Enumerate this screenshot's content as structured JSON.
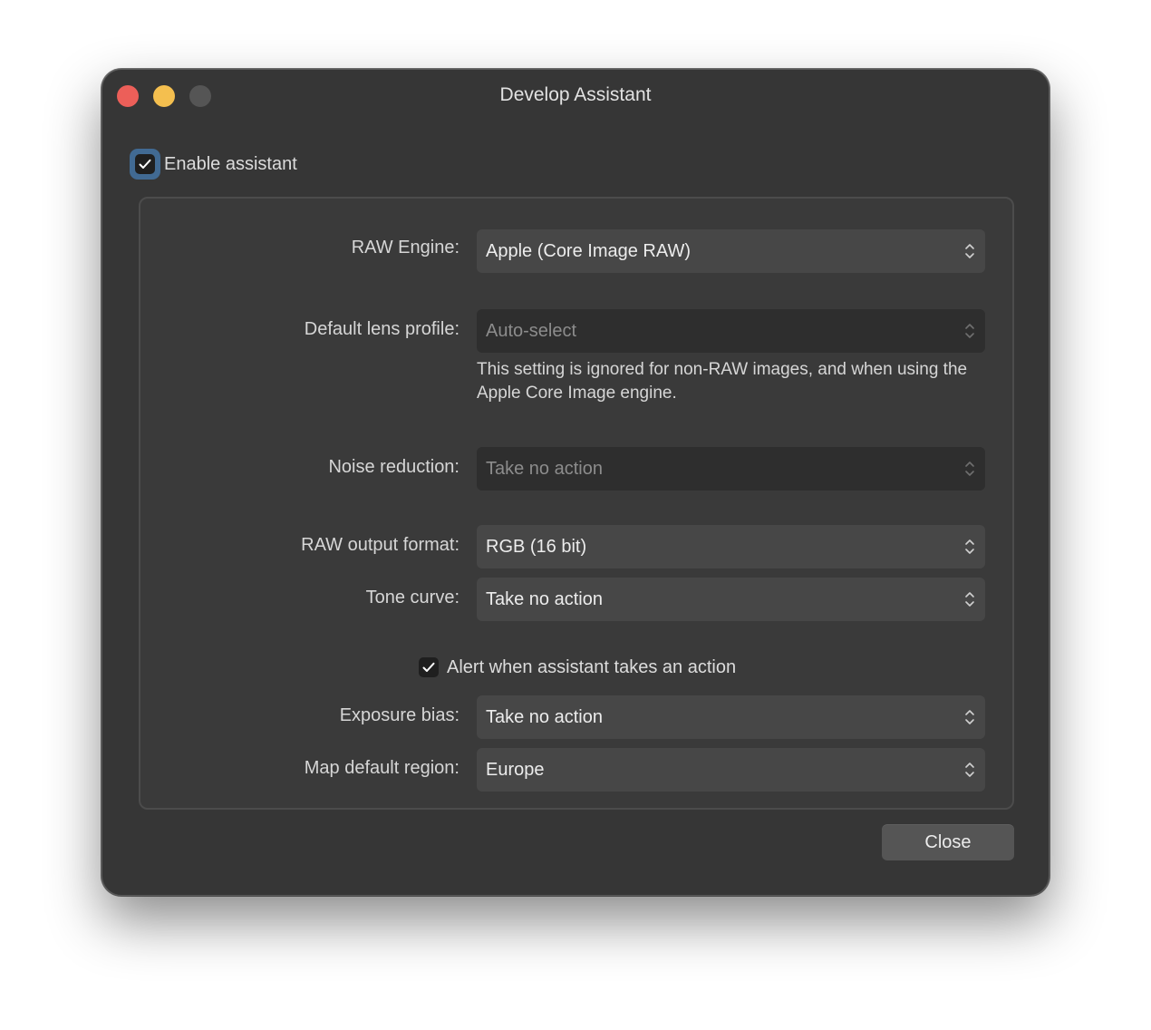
{
  "window": {
    "title": "Develop Assistant",
    "traffic_lights": [
      "close",
      "minimize",
      "zoom"
    ]
  },
  "enable_assistant": {
    "label": "Enable assistant",
    "checked": true
  },
  "settings": {
    "raw_engine": {
      "label": "RAW Engine:",
      "value": "Apple (Core Image RAW)",
      "enabled": true
    },
    "default_lens_profile": {
      "label": "Default lens profile:",
      "value": "Auto-select",
      "enabled": false
    },
    "lens_note": "This setting is ignored for non-RAW images, and when using the Apple Core Image engine.",
    "noise_reduction": {
      "label": "Noise reduction:",
      "value": "Take no action",
      "enabled": false
    },
    "raw_output_format": {
      "label": "RAW output format:",
      "value": "RGB (16 bit)",
      "enabled": true
    },
    "tone_curve": {
      "label": "Tone curve:",
      "value": "Take no action",
      "enabled": true
    },
    "alert": {
      "label": "Alert when assistant takes an action",
      "checked": true
    },
    "exposure_bias": {
      "label": "Exposure bias:",
      "value": "Take no action",
      "enabled": true
    },
    "map_default_region": {
      "label": "Map default region:",
      "value": "Europe",
      "enabled": true
    }
  },
  "buttons": {
    "close": "Close"
  },
  "colors": {
    "window_bg": "#363636",
    "traffic_close": "#ec5f59",
    "traffic_minimize": "#f4bf4f",
    "traffic_zoom_inactive": "#555555",
    "focus_ring": "#416a93"
  }
}
